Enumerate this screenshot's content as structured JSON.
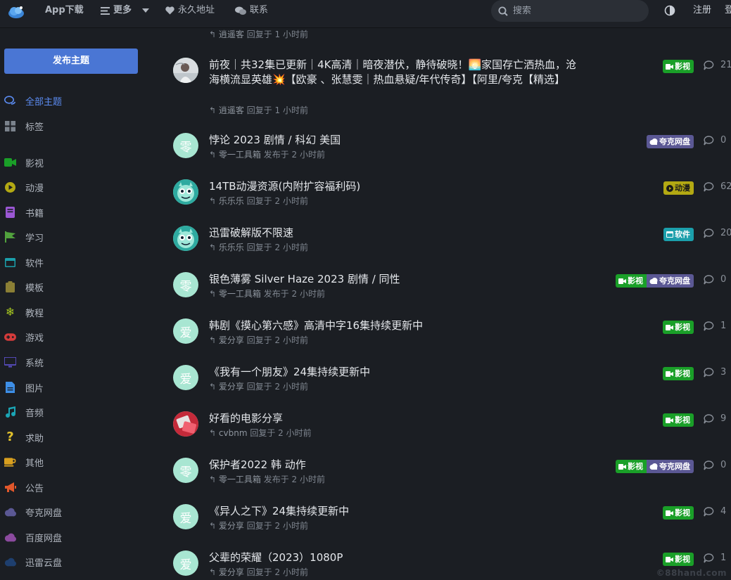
{
  "top": {
    "app_download": "App下载",
    "more": "更多",
    "permanent": "永久地址",
    "contact": "联系",
    "search_placeholder": "搜索",
    "login": "注册",
    "cut_letter": "登"
  },
  "sidebar": {
    "post_button": "发布主题",
    "items": [
      {
        "label": "全部主题",
        "icon": "chat-bubbles-icon",
        "color": "#5b8bf0"
      },
      {
        "label": "标签",
        "icon": "grid-icon",
        "color": "#7b838d"
      },
      {
        "label": "影视",
        "icon": "video-camera-icon",
        "color": "#1a9f28"
      },
      {
        "label": "动漫",
        "icon": "play-circle-icon",
        "color": "#b3a913"
      },
      {
        "label": "书籍",
        "icon": "book-icon",
        "color": "#9b57d4"
      },
      {
        "label": "学习",
        "icon": "flag-icon",
        "color": "#51a13d"
      },
      {
        "label": "软件",
        "icon": "window-icon",
        "color": "#1b9fab"
      },
      {
        "label": "模板",
        "icon": "clipboard-icon",
        "color": "#8b7f35"
      },
      {
        "label": "教程",
        "icon": "snowflake-icon",
        "color": "#a7c820"
      },
      {
        "label": "游戏",
        "icon": "gamepad-icon",
        "color": "#d43b3b"
      },
      {
        "label": "系统",
        "icon": "monitor-icon",
        "color": "#5a4ec4"
      },
      {
        "label": "图片",
        "icon": "file-icon",
        "color": "#3d8ee6"
      },
      {
        "label": "音频",
        "icon": "music-icon",
        "color": "#1ba5b5"
      },
      {
        "label": "求助",
        "icon": "question-icon",
        "color": "#e1c12c"
      },
      {
        "label": "其他",
        "icon": "mug-icon",
        "color": "#d9a01f"
      },
      {
        "label": "公告",
        "icon": "megaphone-icon",
        "color": "#e2572b"
      },
      {
        "label": "夸克网盘",
        "icon": "cloud-icon",
        "color": "#5b5894"
      },
      {
        "label": "百度网盘",
        "icon": "cloud-icon",
        "color": "#8b4a9e"
      },
      {
        "label": "迅雷云盘",
        "icon": "cloud-icon",
        "color": "#1e3f6e"
      }
    ]
  },
  "previous": {
    "user": "逍遥客",
    "action": "回复于 1 小时前"
  },
  "posts": [
    {
      "title": "前夜｜共32集已更新｜4K高清｜暗夜潜伏，静待破晓！🌅家国存亡洒热血，沧海横流显英雄💥【欧豪 、张慧雯｜热血悬疑/年代传奇】【阿里/夸克【精选】",
      "user": "逍遥客",
      "action": "回复于 1 小时前",
      "avatar": "photo",
      "tags": [
        "影视"
      ],
      "replies": "21"
    },
    {
      "title": "悖论 2023 剧情 / 科幻 美国",
      "user": "零一工具箱",
      "action": "发布于 2 小时前",
      "avatar": "零",
      "tags": [
        "夸克网盘"
      ],
      "replies": "0"
    },
    {
      "title": "14TB动漫资源(内附扩容福利码)",
      "user": "乐乐乐",
      "action": "回复于 2 小时前",
      "avatar": "monster",
      "tags": [
        "动漫"
      ],
      "replies": "62"
    },
    {
      "title": "迅雷破解版不限速",
      "user": "乐乐乐",
      "action": "回复于 2 小时前",
      "avatar": "monster",
      "tags": [
        "软件"
      ],
      "replies": "20"
    },
    {
      "title": "银色薄雾 Silver Haze 2023 剧情 / 同性",
      "user": "零一工具箱",
      "action": "发布于 2 小时前",
      "avatar": "零",
      "tags": [
        "影视",
        "夸克网盘"
      ],
      "replies": "0"
    },
    {
      "title": "韩剧《摸心第六感》高清中字16集持续更新中",
      "user": "爱分享",
      "action": "回复于 2 小时前",
      "avatar": "爱",
      "tags": [
        "影视"
      ],
      "replies": "1"
    },
    {
      "title": "《我有一个朋友》24集持续更新中",
      "user": "爱分享",
      "action": "回复于 2 小时前",
      "avatar": "爱",
      "tags": [
        "影视"
      ],
      "replies": "3"
    },
    {
      "title": "好看的电影分享",
      "user": "cvbnm",
      "action": "回复于 2 小时前",
      "avatar": "pic",
      "tags": [
        "影视"
      ],
      "replies": "9"
    },
    {
      "title": "保护者2022 韩 动作",
      "user": "零一工具箱",
      "action": "发布于 2 小时前",
      "avatar": "零",
      "tags": [
        "影视",
        "夸克网盘"
      ],
      "replies": "0"
    },
    {
      "title": "《异人之下》24集持续更新中",
      "user": "爱分享",
      "action": "回复于 2 小时前",
      "avatar": "爱",
      "tags": [
        "影视"
      ],
      "replies": "4"
    },
    {
      "title": "父辈的荣耀（2023）1080P",
      "user": "爱分享",
      "action": "回复于 2 小时前",
      "avatar": "爱",
      "tags": [
        "影视"
      ],
      "replies": "1"
    }
  ],
  "watermark": "©88hand.com"
}
